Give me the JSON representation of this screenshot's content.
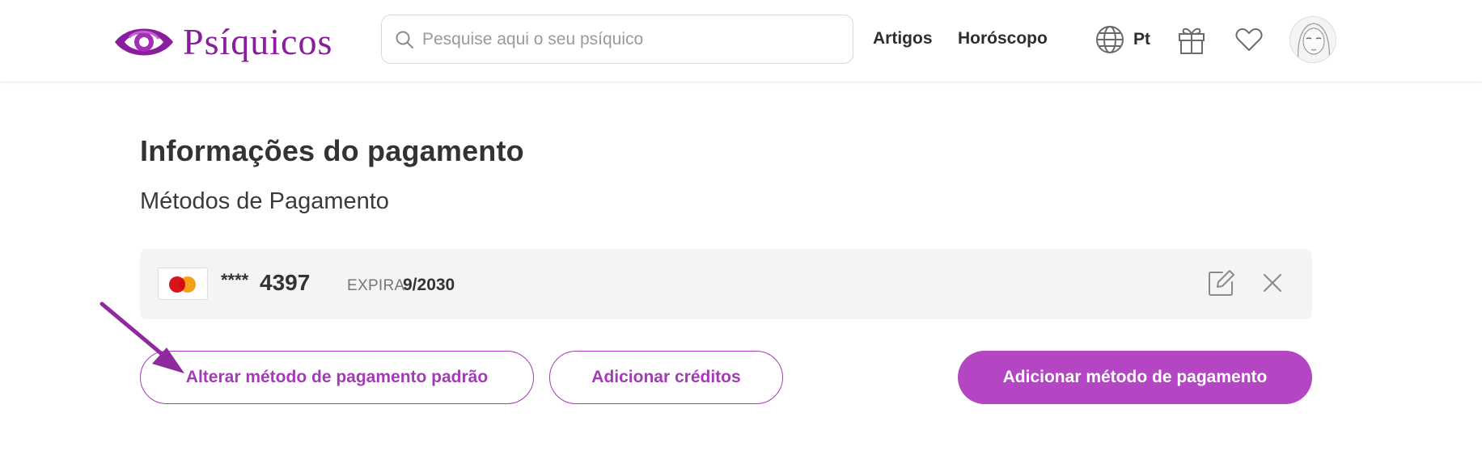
{
  "header": {
    "logo_text": "Psíquicos",
    "search": {
      "placeholder": "Pesquise aqui o seu psíquico",
      "value": ""
    },
    "nav": [
      {
        "label": "Artigos"
      },
      {
        "label": "Horóscopo"
      }
    ],
    "language": {
      "label": "Pt",
      "icon": "globe-icon"
    },
    "icons": [
      "gift-icon",
      "heart-icon"
    ],
    "avatar": "avatar"
  },
  "main": {
    "title": "Informações do pagamento",
    "section_title": "Métodos de Pagamento",
    "card": {
      "brand": "mastercard",
      "mask": "****",
      "last4": "4397",
      "expiry_label": "EXPIRA",
      "expiry_value": "9/2030"
    },
    "buttons": {
      "change_default": "Alterar método de pagamento padrão",
      "add_credits": "Adicionar créditos",
      "add_method": "Adicionar método de pagamento"
    }
  },
  "colors": {
    "brand": "#8a1c9e",
    "accent": "#b445c3",
    "outline": "#a33bb6",
    "annotation_arrow": "#8e2a9e"
  }
}
